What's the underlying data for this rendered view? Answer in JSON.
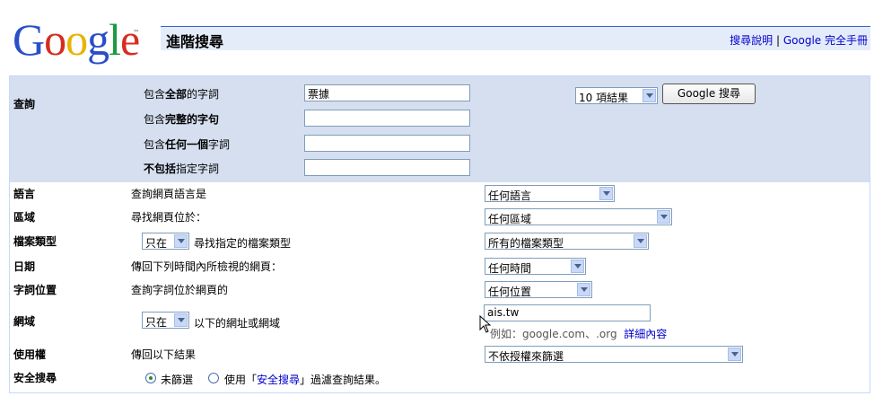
{
  "logo": {
    "letters": [
      "G",
      "o",
      "o",
      "g",
      "l",
      "e"
    ],
    "trademark": "™",
    "alt": "Google"
  },
  "header": {
    "title": "進階搜尋",
    "links": [
      {
        "label": "搜尋說明"
      },
      {
        "label": "Google 完全手冊"
      }
    ],
    "separator": "|"
  },
  "query": {
    "section_label": "查詢",
    "rows": [
      {
        "prefix": "包含",
        "emph": "全部",
        "suffix": "的字詞",
        "value": "票據"
      },
      {
        "prefix": "包含",
        "emph": "完整的字句",
        "suffix": "",
        "value": ""
      },
      {
        "prefix": "包含",
        "emph": "任何一個",
        "suffix": "字詞",
        "value": ""
      },
      {
        "prefix": "",
        "emph": "不包括",
        "suffix": "指定字詞",
        "value": ""
      }
    ],
    "results_select": "10 項結果",
    "search_button": "Google 搜尋"
  },
  "filters": {
    "language": {
      "label": "語言",
      "desc": "查詢網頁語言是",
      "value": "任何語言"
    },
    "region": {
      "label": "區域",
      "desc": "尋找網頁位於：",
      "value": "任何區域"
    },
    "filetype": {
      "label": "檔案類型",
      "mode": "只在",
      "desc": "尋找指定的檔案類型",
      "value": "所有的檔案類型"
    },
    "date": {
      "label": "日期",
      "desc": "傳回下列時間內所檢視的網頁：",
      "value": "任何時間"
    },
    "occurrences": {
      "label": "字詞位置",
      "desc": "查詢字詞位於網頁的",
      "value": "任何位置"
    },
    "domain": {
      "label": "網域",
      "mode": "只在",
      "desc": "以下的網址或網域",
      "value": "ais.tw",
      "hint": "例如：google.com、.org",
      "hint_link": "詳細內容"
    },
    "usage": {
      "label": "使用權",
      "desc": "傳回以下結果",
      "value": "不依授權來篩選"
    },
    "safesearch": {
      "label": "安全搜尋",
      "option_off": "未篩選",
      "option_on_prefix": "使用「",
      "option_on_link": "安全搜尋",
      "option_on_suffix": "」過濾查詢結果。"
    }
  },
  "colors": {
    "query_bg": "#d5dfef",
    "title_bar_bg": "#e5ecf9",
    "link": "#0000cc",
    "border": "#c3d9ff"
  }
}
